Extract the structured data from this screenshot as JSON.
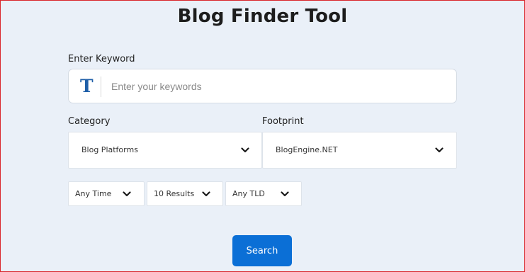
{
  "page": {
    "title": "Blog Finder Tool"
  },
  "keyword": {
    "label": "Enter Keyword",
    "icon": "text-T-icon",
    "icon_glyph": "T",
    "placeholder": "Enter your keywords",
    "value": ""
  },
  "category": {
    "label": "Category",
    "selected": "Blog Platforms"
  },
  "footprint": {
    "label": "Footprint",
    "selected": "BlogEngine.NET"
  },
  "filters": {
    "time": "Any Time",
    "results": "10 Results",
    "tld": "Any TLD"
  },
  "search_button": {
    "label": "Search"
  },
  "colors": {
    "accent": "#0b6fd6",
    "background": "#eaf0f8",
    "icon": "#1f5fa8"
  }
}
